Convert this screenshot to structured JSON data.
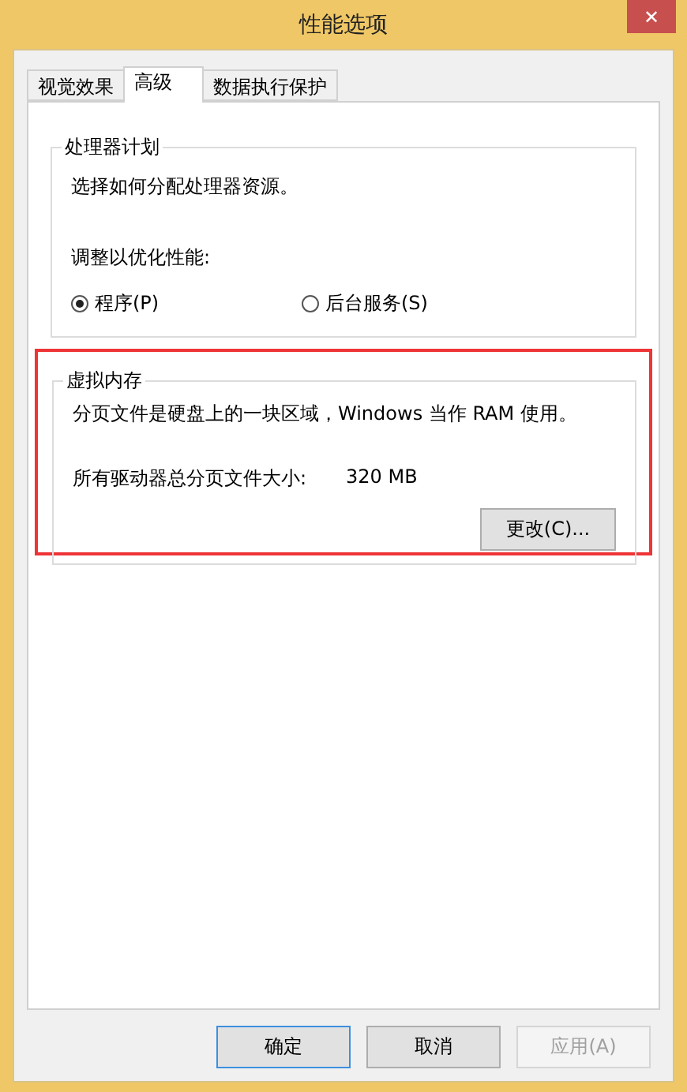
{
  "window": {
    "title": "性能选项",
    "close": "✕"
  },
  "tabs": [
    {
      "label": "视觉效果",
      "selected": false
    },
    {
      "label": "高级",
      "selected": true
    },
    {
      "label": "数据执行保护",
      "selected": false
    }
  ],
  "processor": {
    "title": "处理器计划",
    "description": "选择如何分配处理器资源。",
    "adjust_label": "调整以优化性能:",
    "options": [
      {
        "label": "程序(P)",
        "selected": true
      },
      {
        "label": "后台服务(S)",
        "selected": false
      }
    ]
  },
  "virtual_memory": {
    "title": "虚拟内存",
    "highlighted": true,
    "description": "分页文件是硬盘上的一块区域，Windows 当作 RAM 使用。",
    "size_label": "所有驱动器总分页文件大小:",
    "size_value": "320 MB",
    "change_button": "更改(C)..."
  },
  "buttons": [
    {
      "label": "确定",
      "disabled": false,
      "focused": true
    },
    {
      "label": "取消",
      "disabled": false,
      "focused": false
    },
    {
      "label": "应用(A)",
      "disabled": true,
      "focused": false
    }
  ]
}
